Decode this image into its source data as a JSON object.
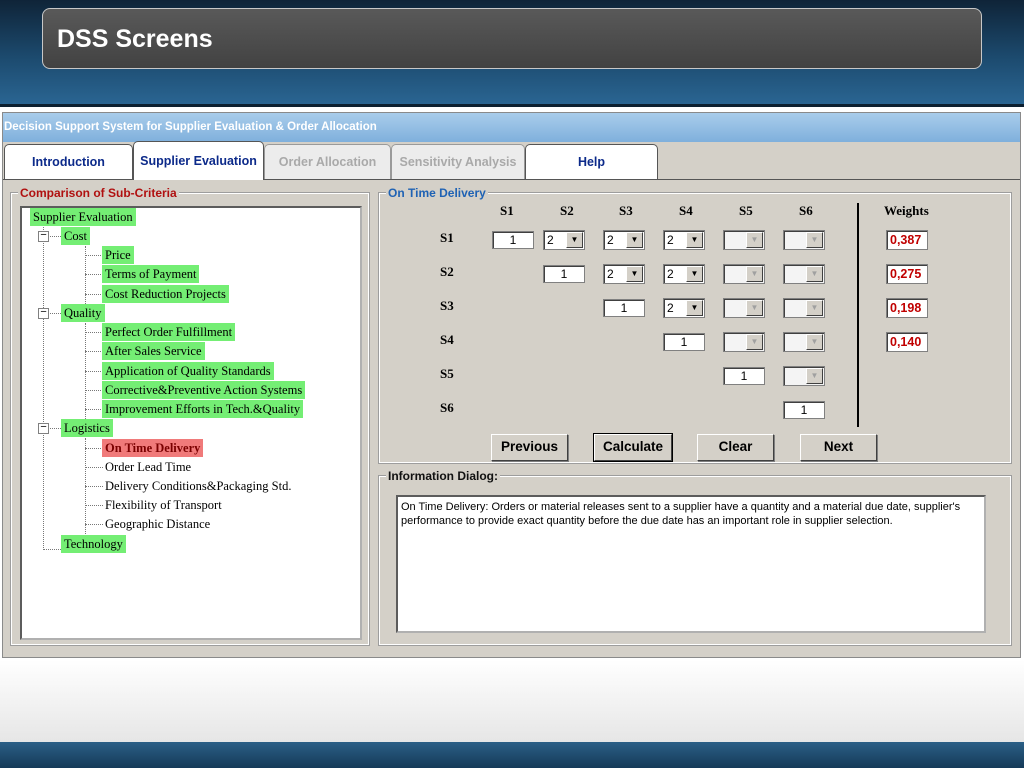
{
  "slide": {
    "title": "DSS Screens"
  },
  "window": {
    "title": "Decision Support System for Supplier Evaluation & Order Allocation"
  },
  "tabs": [
    {
      "label": "Introduction",
      "state": "normal"
    },
    {
      "label": "Supplier Evaluation",
      "state": "active"
    },
    {
      "label": "Order Allocation",
      "state": "disabled"
    },
    {
      "label": "Sensitivity Analysis",
      "state": "disabled"
    },
    {
      "label": "Help",
      "state": "normal"
    }
  ],
  "tree": {
    "legend": "Comparison of Sub-Criteria",
    "root": "Supplier Evaluation",
    "cost": {
      "label": "Cost",
      "expander": "−",
      "items": [
        "Price",
        "Terms of Payment",
        "Cost Reduction Projects"
      ]
    },
    "quality": {
      "label": "Quality",
      "expander": "−",
      "items": [
        "Perfect Order Fulfillment",
        "After Sales Service",
        "Application of Quality Standards",
        "Corrective&Preventive Action Systems",
        "Improvement Efforts in Tech.&Quality"
      ]
    },
    "logistics": {
      "label": "Logistics",
      "expander": "−",
      "items": [
        "On Time Delivery",
        "Order Lead Time",
        "Delivery Conditions&Packaging Std.",
        "Flexibility of Transport",
        "Geographic Distance"
      ]
    },
    "technology": {
      "label": "Technology"
    },
    "selected": "On Time Delivery"
  },
  "matrix": {
    "legend": "On Time Delivery",
    "columns": [
      "S1",
      "S2",
      "S3",
      "S4",
      "S5",
      "S6"
    ],
    "rows": [
      "S1",
      "S2",
      "S3",
      "S4",
      "S5",
      "S6"
    ],
    "diagonal": "1",
    "combo_values": {
      "s1_s2": "2",
      "s1_s3": "2",
      "s1_s4": "2",
      "s2_s3": "2",
      "s2_s4": "2",
      "s3_s4": "2"
    },
    "arrow_glyph": "▼",
    "weights_header": "Weights",
    "weights": [
      "0,387",
      "0,275",
      "0,198",
      "0,140"
    ]
  },
  "buttons": {
    "previous": "Previous",
    "calculate": "Calculate",
    "clear": "Clear",
    "next": "Next"
  },
  "info": {
    "legend": "Information Dialog:",
    "text": "On Time Delivery: Orders or material releases sent to a supplier have a quantity and a material due date, supplier's performance to provide exact quantity before the due date has an important role in supplier selection."
  },
  "colors": {
    "green_node": "#74ee74",
    "selected_node": "#f07a7a",
    "weight_text": "#c00000",
    "titlebar": "#7fb0dc"
  }
}
